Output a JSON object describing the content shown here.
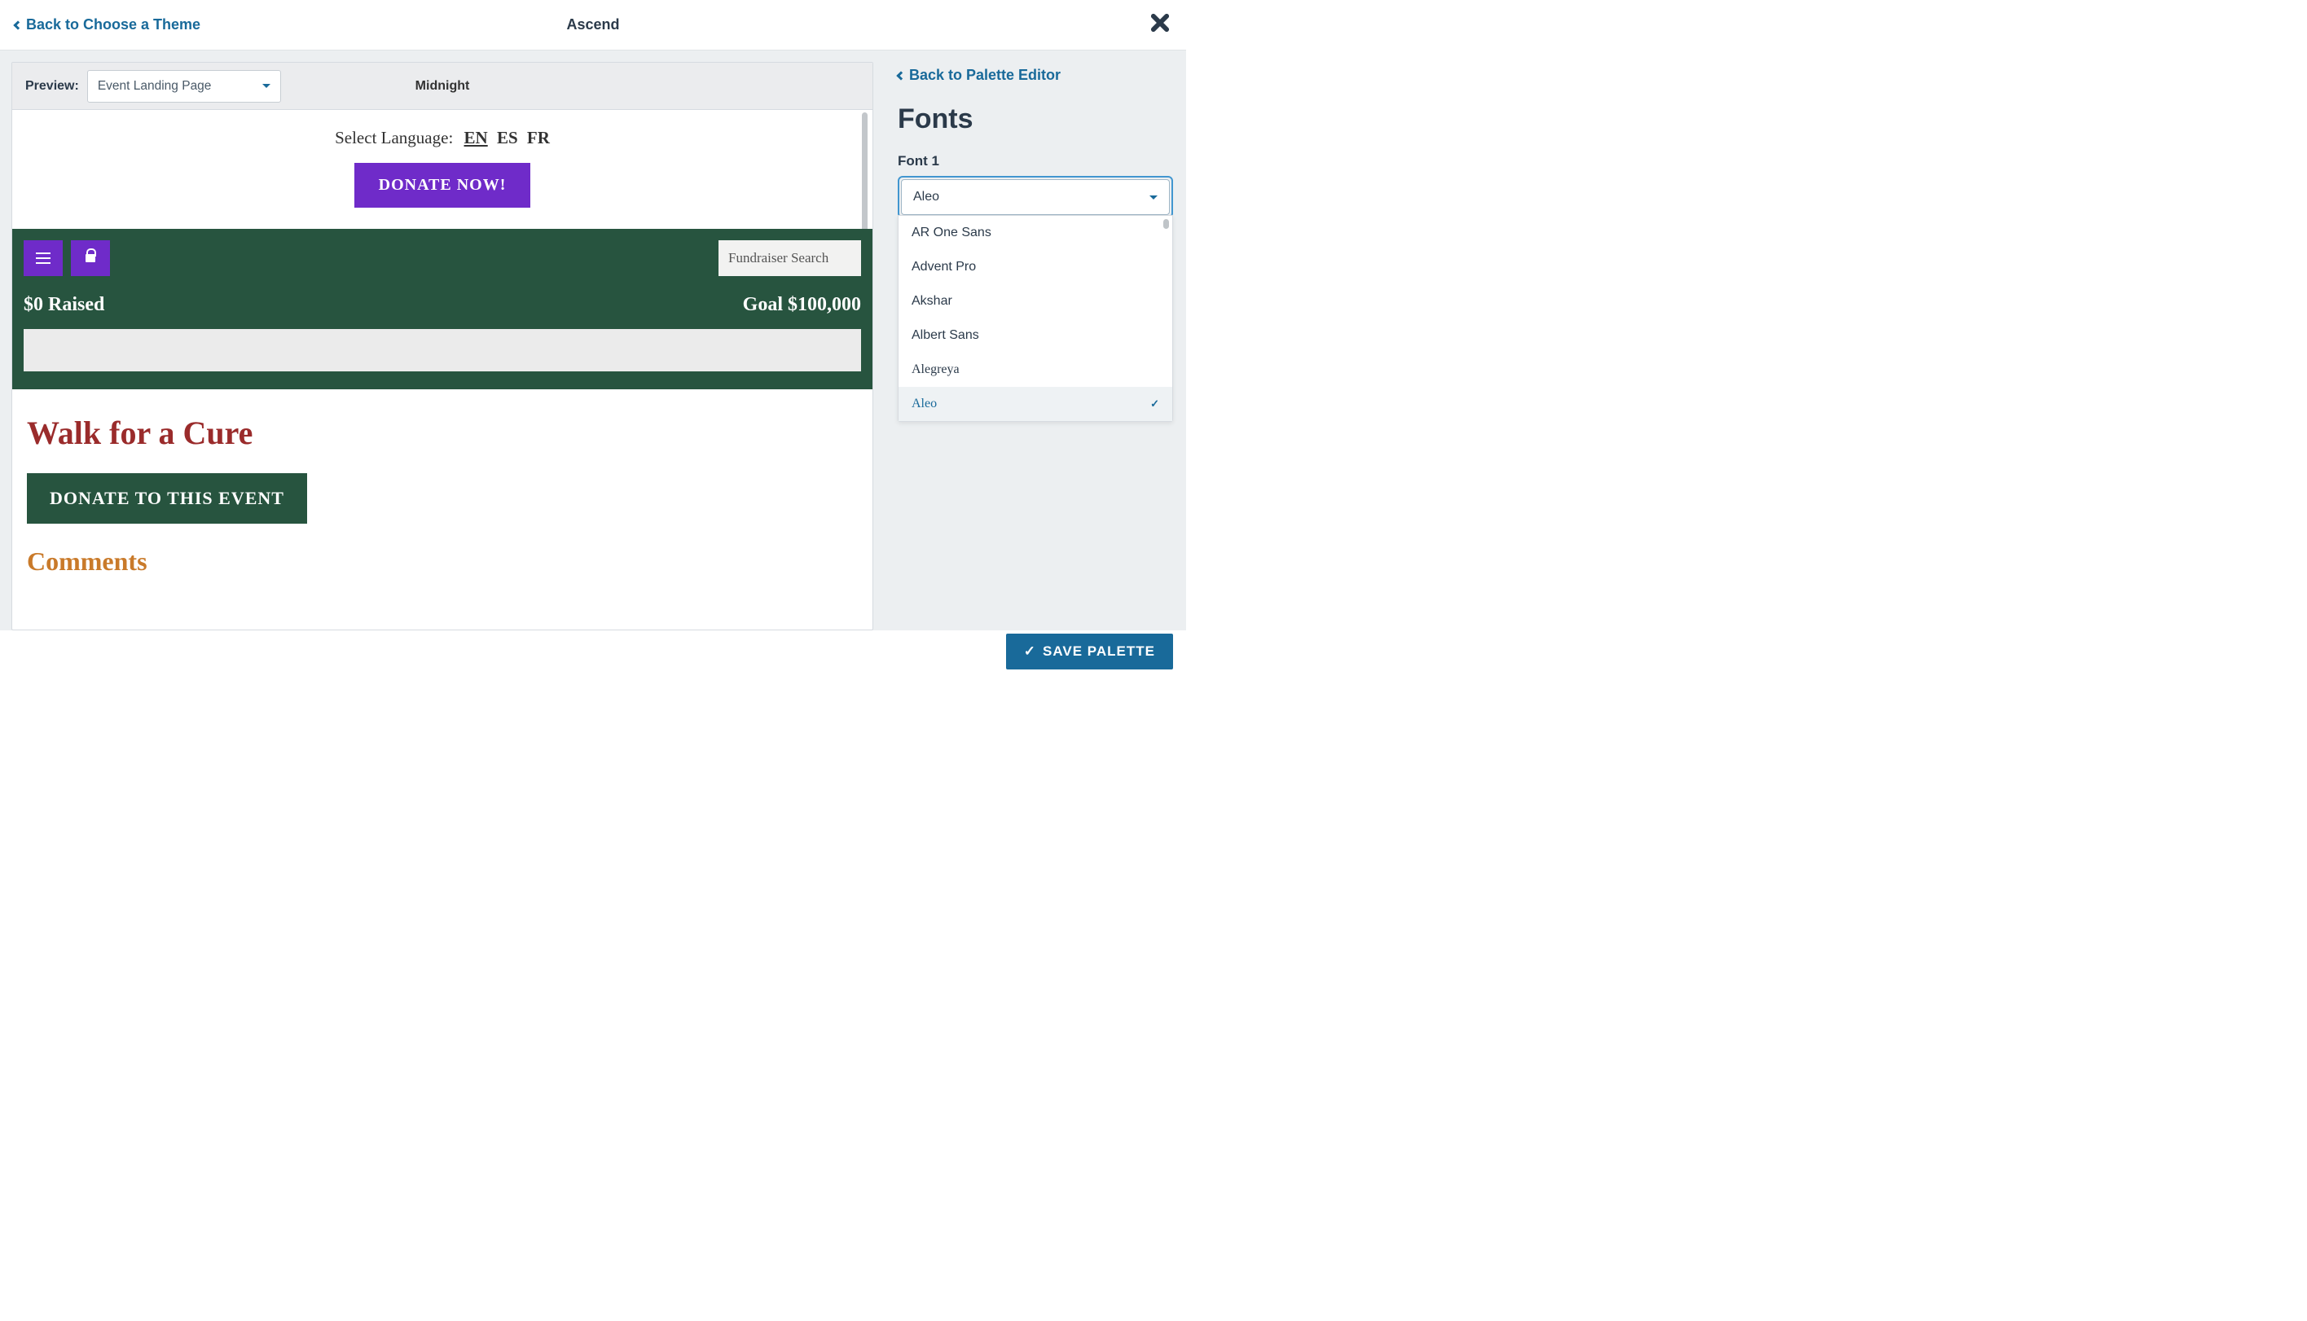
{
  "topbar": {
    "back_label": "Back to Choose a Theme",
    "title": "Ascend"
  },
  "preview": {
    "label": "Preview:",
    "selected": "Event Landing Page",
    "theme_name": "Midnight",
    "language_label": "Select Language:",
    "lang_en": "EN",
    "lang_es": "ES",
    "lang_fr": "FR",
    "donate_now": "DONATE NOW!",
    "fundraiser_search_placeholder": "Fundraiser Search",
    "raised_label": "$0 Raised",
    "goal_label": "Goal $100,000",
    "event_title": "Walk for a Cure",
    "donate_event": "DONATE TO THIS EVENT",
    "comments_heading": "Comments"
  },
  "right": {
    "back_palette": "Back to Palette Editor",
    "fonts_heading": "Fonts",
    "font1_label": "Font 1",
    "font1_selected": "Aleo",
    "options": [
      {
        "name": "AR One Sans",
        "font": "Arial, sans-serif",
        "selected": false
      },
      {
        "name": "Advent Pro",
        "font": "'Trebuchet MS', sans-serif",
        "selected": false
      },
      {
        "name": "Akshar",
        "font": "Arial Black, sans-serif",
        "selected": false
      },
      {
        "name": "Albert Sans",
        "font": "Arial, sans-serif",
        "selected": false
      },
      {
        "name": "Alegreya",
        "font": "Georgia, serif",
        "selected": false
      },
      {
        "name": "Aleo",
        "font": "Georgia, serif",
        "selected": true
      }
    ]
  },
  "footer": {
    "save_label": "SAVE PALETTE"
  }
}
